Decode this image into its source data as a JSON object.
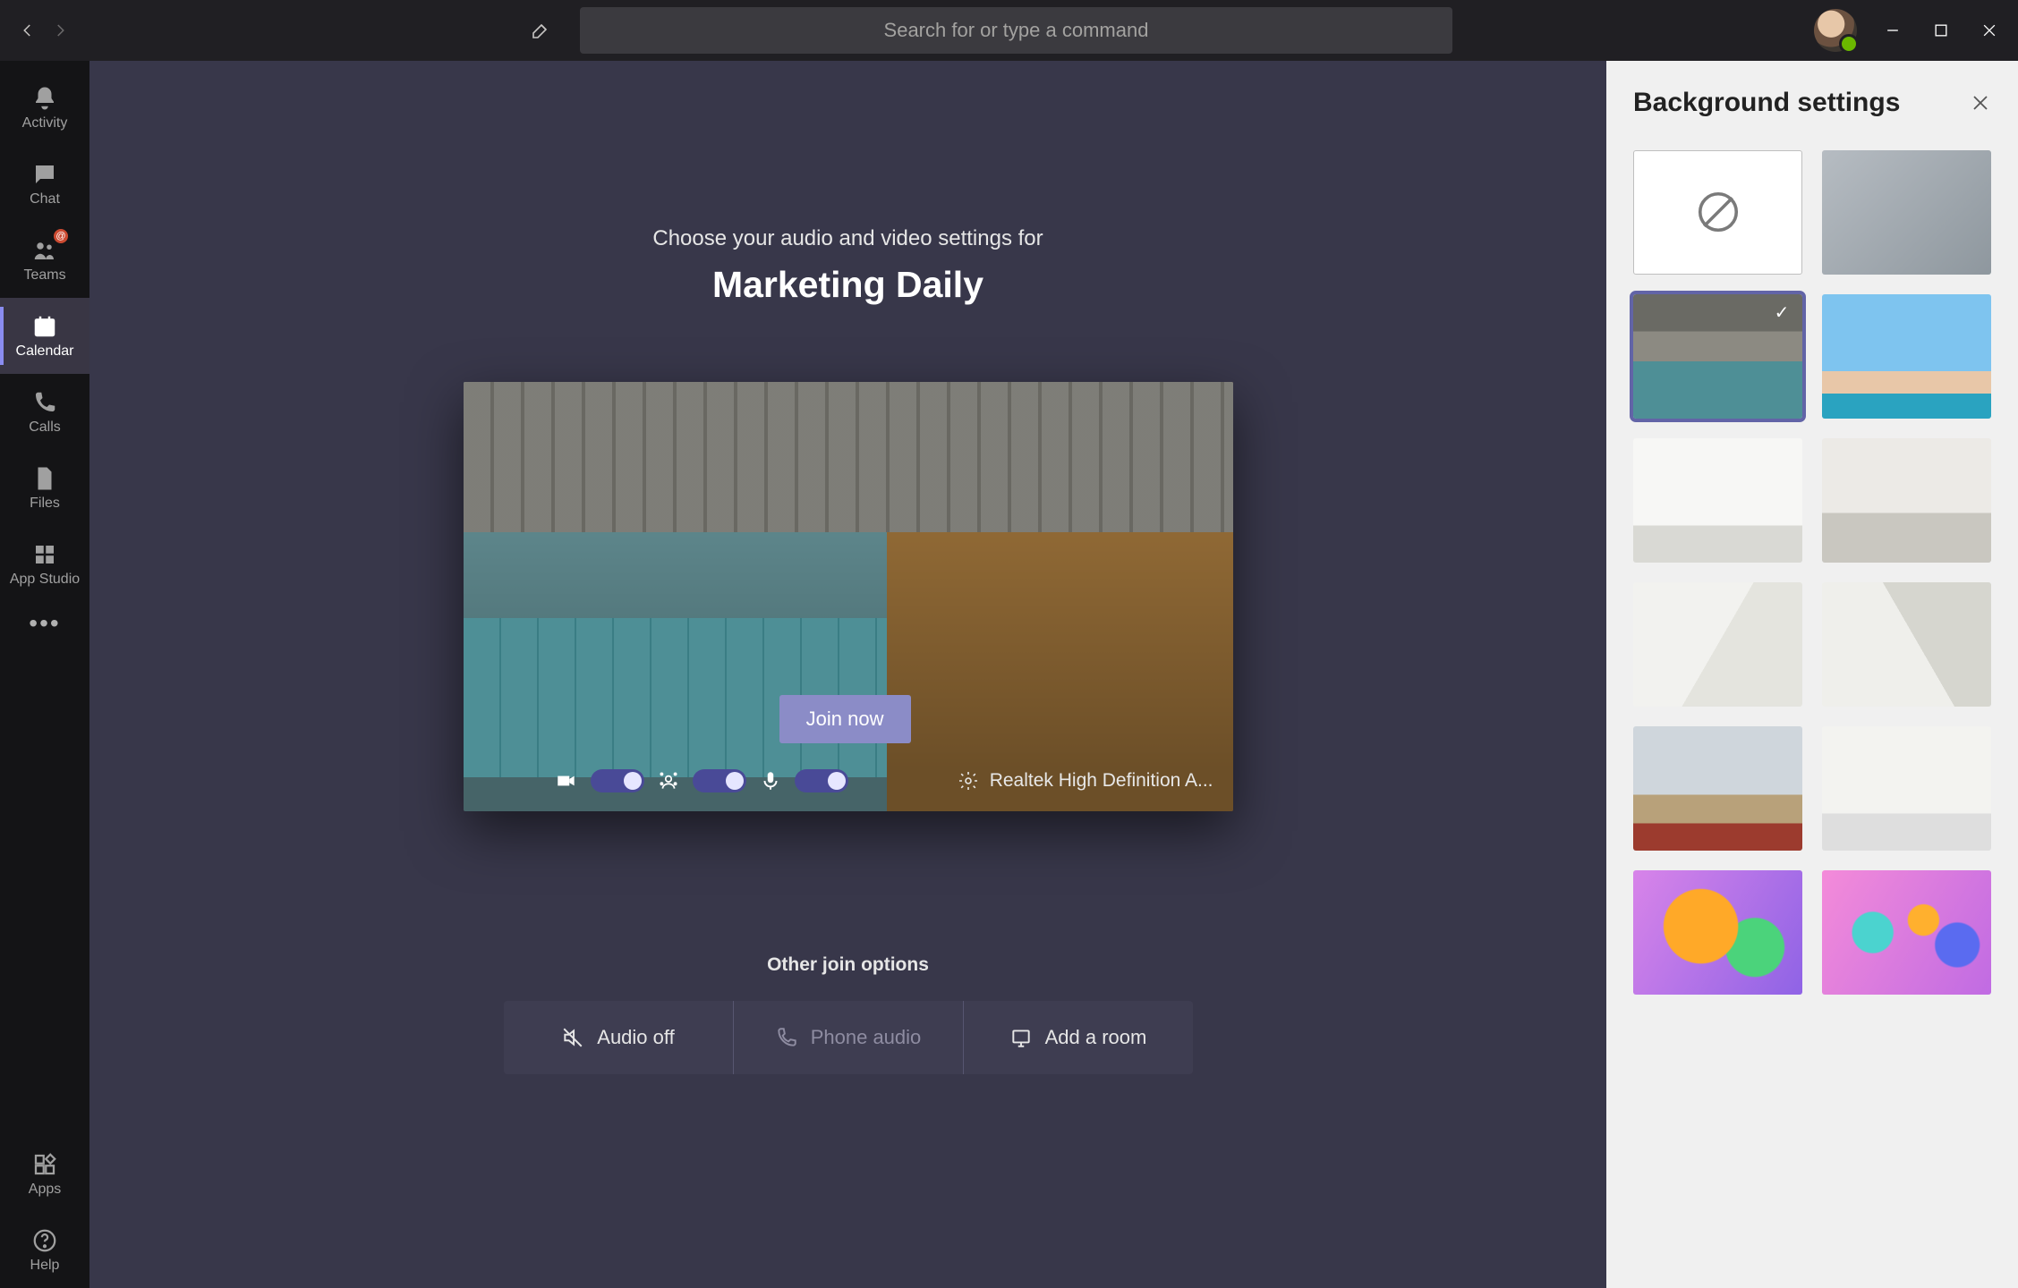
{
  "titlebar": {
    "search_placeholder": "Search for or type a command"
  },
  "rail": {
    "items": [
      {
        "id": "activity",
        "label": "Activity"
      },
      {
        "id": "chat",
        "label": "Chat"
      },
      {
        "id": "teams",
        "label": "Teams",
        "badge": "@"
      },
      {
        "id": "calendar",
        "label": "Calendar",
        "active": true
      },
      {
        "id": "calls",
        "label": "Calls"
      },
      {
        "id": "files",
        "label": "Files"
      },
      {
        "id": "appstudio",
        "label": "App Studio"
      }
    ],
    "bottom": [
      {
        "id": "apps",
        "label": "Apps"
      },
      {
        "id": "help",
        "label": "Help"
      }
    ]
  },
  "prejoin": {
    "subtitle": "Choose your audio and video settings for",
    "meeting_title": "Marketing Daily",
    "join_label": "Join now",
    "device_label": "Realtek High Definition A...",
    "toggles": {
      "camera_on": true,
      "background_fx_on": true,
      "mic_on": true
    },
    "other_options_heading": "Other join options",
    "options": {
      "audio_off": "Audio off",
      "phone_audio": "Phone audio",
      "add_room": "Add a room"
    }
  },
  "panel": {
    "title": "Background settings",
    "tiles": [
      {
        "id": "none",
        "kind": "none"
      },
      {
        "id": "blur",
        "kind": "blur"
      },
      {
        "id": "lockers",
        "kind": "image",
        "selected": true
      },
      {
        "id": "sky",
        "kind": "image"
      },
      {
        "id": "white1",
        "kind": "image"
      },
      {
        "id": "white2",
        "kind": "image"
      },
      {
        "id": "white3",
        "kind": "image"
      },
      {
        "id": "white4",
        "kind": "image"
      },
      {
        "id": "office",
        "kind": "image"
      },
      {
        "id": "white5",
        "kind": "image"
      },
      {
        "id": "balloon1",
        "kind": "image"
      },
      {
        "id": "balloon2",
        "kind": "image"
      }
    ]
  },
  "colors": {
    "accent": "#6264a7",
    "stage_bg": "#38374a",
    "rail_bg": "#141416",
    "titlebar_bg": "#201f23"
  }
}
